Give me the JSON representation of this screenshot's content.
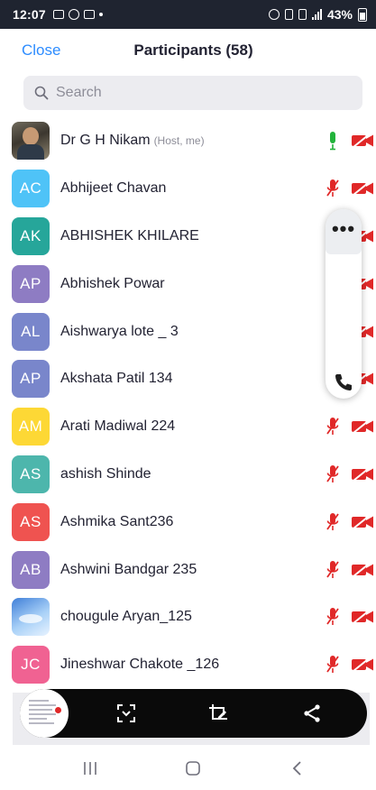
{
  "status_bar": {
    "time": "12:07",
    "battery": "43%",
    "left_icons": [
      "gallery-icon",
      "whatsapp-icon",
      "message-icon",
      "dot-icon"
    ],
    "right_icons": [
      "alarm-icon",
      "volte-icon",
      "4g-icon",
      "signal-icon",
      "battery-icon"
    ]
  },
  "header": {
    "close_label": "Close",
    "title": "Participants (58)"
  },
  "search": {
    "placeholder": "Search"
  },
  "colors": {
    "accent": "#2d8cff",
    "mic_muted": "#e02828",
    "mic_active": "#22b33b",
    "cam_off": "#e02828"
  },
  "participants": [
    {
      "name": "Dr G H Nikam",
      "tag": "(Host, me)",
      "initials": "",
      "avatar_color": "",
      "avatar_image": "photo-man",
      "mic": "on"
    },
    {
      "name": "Abhijeet Chavan",
      "tag": "",
      "initials": "AC",
      "avatar_color": "#4fc3f7",
      "mic": "muted"
    },
    {
      "name": "ABHISHEK KHILARE",
      "tag": "",
      "initials": "AK",
      "avatar_color": "#26a69a",
      "mic": "muted"
    },
    {
      "name": "Abhishek Powar",
      "tag": "",
      "initials": "AP",
      "avatar_color": "#8e7cc3",
      "mic": "muted"
    },
    {
      "name": "Aishwarya lote _ 3",
      "tag": "",
      "initials": "AL",
      "avatar_color": "#7986cb",
      "mic": "muted"
    },
    {
      "name": "Akshata Patil 134",
      "tag": "",
      "initials": "AP",
      "avatar_color": "#7986cb",
      "mic": "muted"
    },
    {
      "name": "Arati Madiwal 224",
      "tag": "",
      "initials": "AM",
      "avatar_color": "#fdd835",
      "mic": "muted"
    },
    {
      "name": "ashish Shinde",
      "tag": "",
      "initials": "AS",
      "avatar_color": "#4db6ac",
      "mic": "muted"
    },
    {
      "name": "Ashmika Sant236",
      "tag": "",
      "initials": "AS",
      "avatar_color": "#ef5350",
      "mic": "muted"
    },
    {
      "name": "Ashwini Bandgar 235",
      "tag": "",
      "initials": "AB",
      "avatar_color": "#8e7cc3",
      "mic": "muted"
    },
    {
      "name": "chougule Aryan_125",
      "tag": "",
      "initials": "",
      "avatar_color": "",
      "avatar_image": "photo-sky",
      "mic": "muted"
    },
    {
      "name": "Jineshwar Chakote _126",
      "tag": "",
      "initials": "JC",
      "avatar_color": "#f06292",
      "mic": "muted"
    }
  ],
  "floating_controls": {
    "more_label": "•••",
    "icons": [
      "more-icon",
      "phone-icon"
    ]
  },
  "toolbar": {
    "icons": [
      "screen-thumbnail",
      "screenshot-icon",
      "crop-edit-icon",
      "share-icon"
    ]
  },
  "nav_bar": {
    "icons": [
      "recent-apps-icon",
      "home-icon",
      "back-icon"
    ]
  }
}
